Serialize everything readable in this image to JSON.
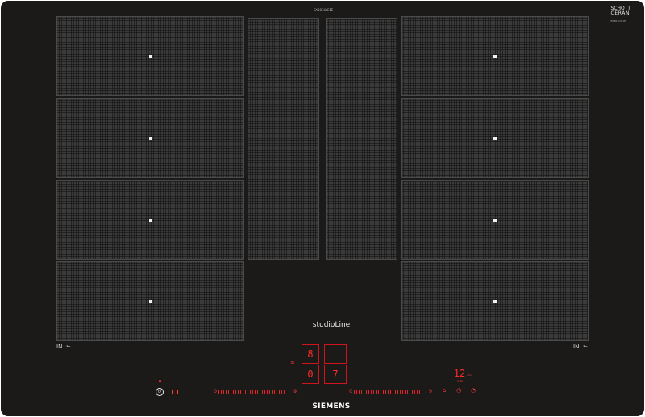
{
  "cooktop": {
    "model_code": "EX801LYC1E",
    "glass_brand": {
      "line1": "SCHOTT",
      "line2": "CERAN",
      "line3": "EX801LYC1E"
    },
    "product_line": "studioLine",
    "manufacturer": "SIEMENS",
    "left_marker": {
      "label": "IN",
      "icon": "hob-arrow-icon"
    },
    "right_marker": {
      "label": "IN",
      "icon": "hob-arrow-icon"
    }
  },
  "zones": {
    "left": [
      "zone-left-1",
      "zone-left-2",
      "zone-left-3",
      "zone-left-4"
    ],
    "center": [
      "zone-center-left",
      "zone-center-right"
    ],
    "right": [
      "zone-right-1",
      "zone-right-2",
      "zone-right-3",
      "zone-right-4"
    ]
  },
  "display": {
    "zone_top_left": "8",
    "zone_bottom_left": "0",
    "zone_bottom_right": "7",
    "timer": "12",
    "timer_unit": "min",
    "timer_sub": "1-99"
  },
  "controls": {
    "power_icon": "power-icon",
    "left_slider_min": "0",
    "left_slider_max": "9",
    "right_slider_min": "0",
    "right_slider_max": "9"
  },
  "colors": {
    "glass": "#1c1a19",
    "zone": "#3b3b3b",
    "display_red": "#ff2a2a",
    "text": "#e8e8e8"
  }
}
